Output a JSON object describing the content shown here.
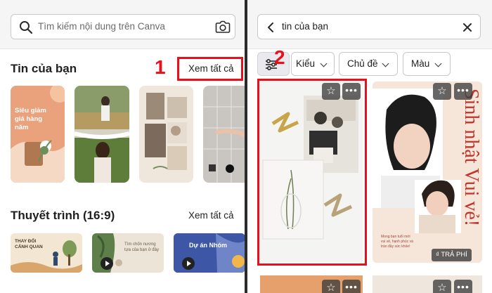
{
  "left": {
    "search": {
      "placeholder": "Tìm kiếm nội dung trên Canva",
      "icon": "search-icon",
      "camera_icon": "camera-icon"
    },
    "your_stories": {
      "title": "Tin của bạn",
      "see_all": "Xem tất cả",
      "step": "1"
    },
    "story_cards": [
      {
        "headline": "Siêu giảm giá hàng năm",
        "bg": "#e9a27c"
      },
      {
        "headline": "",
        "bg": "#6f8a56"
      },
      {
        "headline": "",
        "bg": "#efe7dc"
      },
      {
        "headline": "",
        "bg": "#c9c6c2"
      }
    ],
    "presentations": {
      "title": "Thuyết trình (16:9)",
      "see_all": "Xem tất cả",
      "items": [
        {
          "line1": "THAY ĐỔI",
          "line2": "CẢNH QUAN"
        },
        {
          "line1": "Tìm chốn nương",
          "line2": "tựa của bạn ở đây"
        },
        {
          "line1": "Dự án Nhóm",
          "line2": ""
        }
      ]
    }
  },
  "right": {
    "search": {
      "value": "tin của bạn",
      "back_icon": "chevron-left-icon",
      "close_icon": "close-icon"
    },
    "step": "2",
    "filters": {
      "settings_icon": "sliders-icon",
      "style": "Kiểu",
      "topic": "Chủ đề",
      "color": "Màu"
    },
    "results": [
      {
        "kind": "photo-collage"
      },
      {
        "title": "Sinh nhật Vui vẻ!",
        "caption": "Mong bạn tuổi mới vui vẻ, hạnh phúc và tràn đầy sức khỏe!",
        "badge": "₫ TRẢ PHÍ"
      }
    ]
  },
  "colors": {
    "accent_red": "#e8101b",
    "text": "#1f1f1f",
    "divider": "#2b2b2b"
  }
}
